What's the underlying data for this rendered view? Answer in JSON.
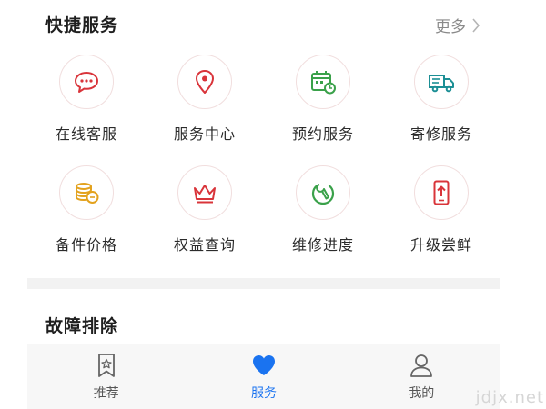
{
  "quick_services": {
    "title": "快捷服务",
    "more_label": "更多",
    "items": [
      {
        "label": "在线客服",
        "icon": "chat-bubble-icon"
      },
      {
        "label": "服务中心",
        "icon": "location-pin-icon"
      },
      {
        "label": "预约服务",
        "icon": "calendar-clock-icon"
      },
      {
        "label": "寄修服务",
        "icon": "delivery-truck-icon"
      },
      {
        "label": "备件价格",
        "icon": "coins-icon"
      },
      {
        "label": "权益查询",
        "icon": "crown-icon"
      },
      {
        "label": "维修进度",
        "icon": "wrench-progress-icon"
      },
      {
        "label": "升级尝鲜",
        "icon": "phone-upgrade-icon"
      }
    ]
  },
  "troubleshooting": {
    "title": "故障排除"
  },
  "tabbar": {
    "tabs": [
      {
        "label": "推荐",
        "icon": "bookmark-star-icon",
        "active": false
      },
      {
        "label": "服务",
        "icon": "heart-icon",
        "active": true
      },
      {
        "label": "我的",
        "icon": "user-icon",
        "active": false
      }
    ]
  },
  "watermark": "jdjx.net",
  "colors": {
    "red": "#d9343a",
    "green": "#3aa14a",
    "teal": "#1c8f95",
    "gold": "#e3a21e",
    "active_blue": "#1a73f0",
    "circle_border": "#f1dede"
  }
}
